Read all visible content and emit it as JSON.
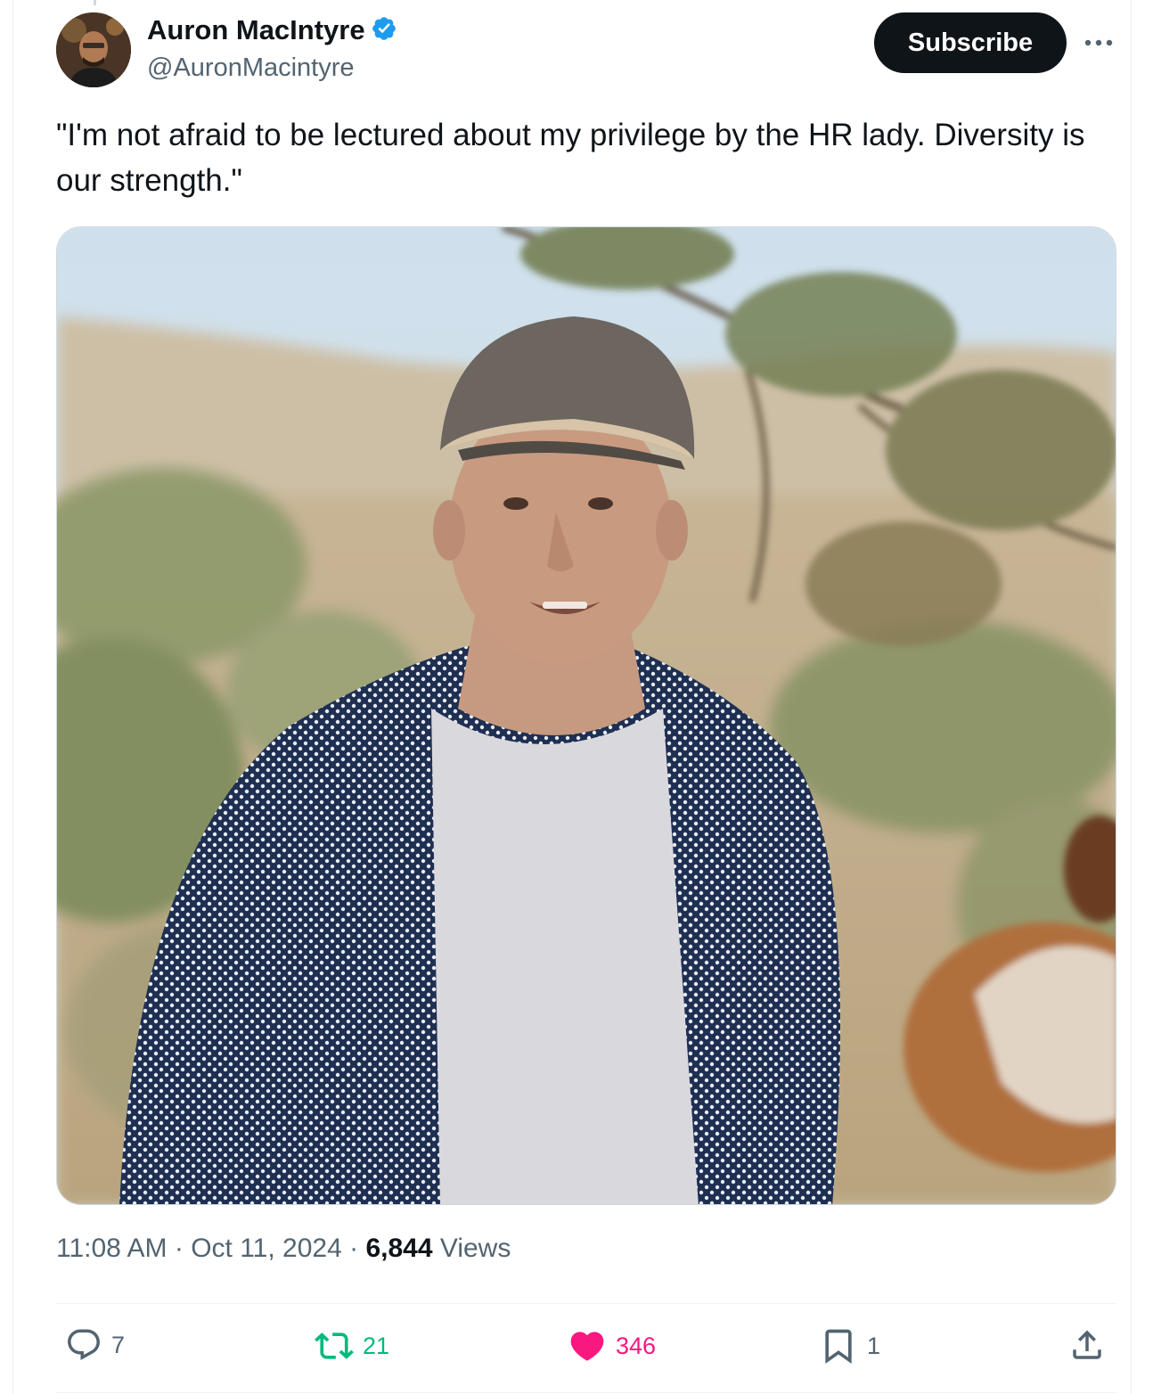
{
  "author": {
    "display_name": "Auron MacIntyre",
    "handle": "@AuronMacintyre",
    "verified_icon": "verified-badge-icon"
  },
  "header": {
    "subscribe_label": "Subscribe",
    "more_icon": "more-horizontal-icon"
  },
  "tweet": {
    "text": "\"I'm not afraid to be lectured about my privilege by the HR lady. Diversity is our strength.\"",
    "media_icon": "video-thumbnail"
  },
  "meta": {
    "time": "11:08 AM",
    "sep1": " · ",
    "date": "Oct 11, 2024",
    "sep2": " · ",
    "views_count": "6,844",
    "views_label": " Views"
  },
  "actions": {
    "reply_count": "7",
    "retweet_count": "21",
    "like_count": "346",
    "bookmark_count": "1"
  },
  "colors": {
    "text_primary": "#0f1419",
    "text_secondary": "#536471",
    "verified_blue": "#1d9bf0",
    "retweet_green": "#00ba7c",
    "like_pink": "#f91880"
  }
}
